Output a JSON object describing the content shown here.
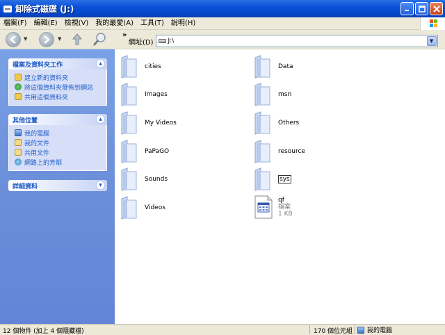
{
  "window": {
    "title": "卸除式磁碟 (J:)",
    "min_icon": "minimize-icon",
    "max_icon": "maximize-icon",
    "close_icon": "close-icon"
  },
  "menu": [
    "檔案(F)",
    "編輯(E)",
    "檢視(V)",
    "我的最愛(A)",
    "工具(T)",
    "說明(H)"
  ],
  "toolbar": {
    "back_icon": "back-arrow-icon",
    "forward_icon": "forward-arrow-icon",
    "up_icon": "up-folder-icon",
    "search_icon": "search-icon",
    "more": "»"
  },
  "address": {
    "label": "網址(D)",
    "value": "J:\\"
  },
  "tasks": {
    "title": "檔案及資料夾工作",
    "items": [
      "建立新的資料夾",
      "將這個資料夾發佈到網站",
      "共用這個資料夾"
    ]
  },
  "other_places": {
    "title": "其他位置",
    "items": [
      "我的電腦",
      "我的文件",
      "共用文件",
      "網路上的芳鄰"
    ]
  },
  "details": {
    "title": "詳細資料"
  },
  "folders": {
    "left": [
      "cities",
      "Images",
      "My Videos",
      "PaPaGO",
      "Sounds",
      "Videos"
    ],
    "right": [
      "Data",
      "msn",
      "Others",
      "resource",
      "sys"
    ]
  },
  "file": {
    "name": "qf",
    "type": "檔案",
    "size": "1 KB"
  },
  "status": {
    "objects": "12 個物件 (加上 4 個隱藏檔)",
    "size": "170 個位元組",
    "location": "我的電腦"
  },
  "colors": {
    "titlebar": "#0a50d8",
    "taskpane": "#6b8fd9",
    "link": "#215dc6"
  }
}
